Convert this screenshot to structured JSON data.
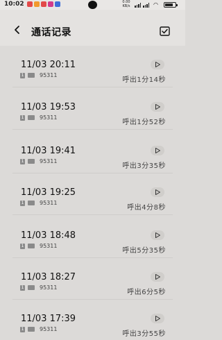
{
  "status_bar": {
    "time": "10:02",
    "net_speed": "0.00 KB/s",
    "notification_colors": [
      "#e24a4a",
      "#f29a2e",
      "#e24a4a",
      "#d23c8c",
      "#3f6fd9"
    ]
  },
  "header": {
    "title": "通话记录",
    "back_icon": "chevron-left-icon",
    "select_icon": "checkbox-icon"
  },
  "calls": [
    {
      "time": "11/03 20:11",
      "sim": "1",
      "number": "95311",
      "duration": "呼出1分14秒"
    },
    {
      "time": "11/03 19:53",
      "sim": "1",
      "number": "95311",
      "duration": "呼出1分52秒"
    },
    {
      "time": "11/03 19:41",
      "sim": "1",
      "number": "95311",
      "duration": "呼出3分35秒"
    },
    {
      "time": "11/03 19:25",
      "sim": "1",
      "number": "95311",
      "duration": "呼出4分8秒"
    },
    {
      "time": "11/03 18:48",
      "sim": "1",
      "number": "95311",
      "duration": "呼出5分35秒"
    },
    {
      "time": "11/03 18:27",
      "sim": "1",
      "number": "95311",
      "duration": "呼出6分5秒"
    },
    {
      "time": "11/03 17:39",
      "sim": "1",
      "number": "95311",
      "duration": "呼出3分55秒"
    }
  ]
}
